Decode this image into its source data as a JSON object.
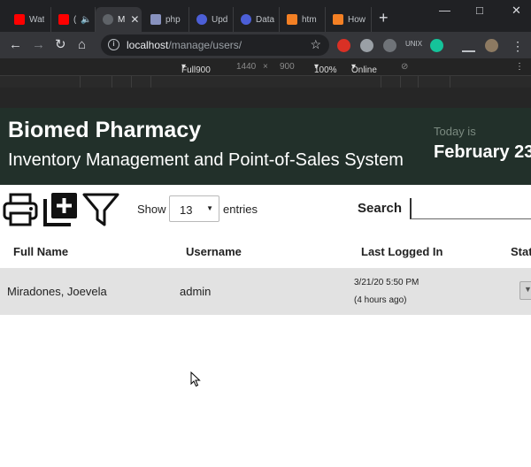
{
  "browser": {
    "tabs": [
      {
        "title": "Wat",
        "favicon_color": "#ff0000"
      },
      {
        "title": "(",
        "favicon_color": "#ff0000"
      },
      {
        "title": "M",
        "favicon_color": "#5f6368"
      },
      {
        "title": "php",
        "favicon_color": "#8892bf"
      },
      {
        "title": "Upd",
        "favicon_color": "#4c5fd7"
      },
      {
        "title": "Data",
        "favicon_color": "#4c5fd7"
      },
      {
        "title": "htm",
        "favicon_color": "#f48024"
      },
      {
        "title": "How",
        "favicon_color": "#f48024"
      }
    ],
    "url_host": "localhost",
    "url_path": "/manage/users/",
    "extensions": {
      "unix_label": "UNIX"
    }
  },
  "devtools": {
    "device": "Full900",
    "width": "1440",
    "times": "×",
    "height": "900",
    "zoom": "100%",
    "network": "Online"
  },
  "header": {
    "brand": "Biomed Pharmacy",
    "subtitle": "Inventory Management and Point-of-Sales System",
    "today_label": "Today is",
    "date": "February 23"
  },
  "toolbar": {
    "show_label": "Show",
    "entries_value": "13",
    "entries_label": "entries",
    "search_label": "Search",
    "search_value": ""
  },
  "table": {
    "columns": [
      "Full Name",
      "Username",
      "Last Logged In",
      "Stat"
    ],
    "rows": [
      {
        "full_name": "Miradones, Joevela",
        "username": "admin",
        "last_logged_in": "3/21/20 5:50 PM",
        "last_logged_in_relative": "(4 hours ago)"
      }
    ]
  }
}
